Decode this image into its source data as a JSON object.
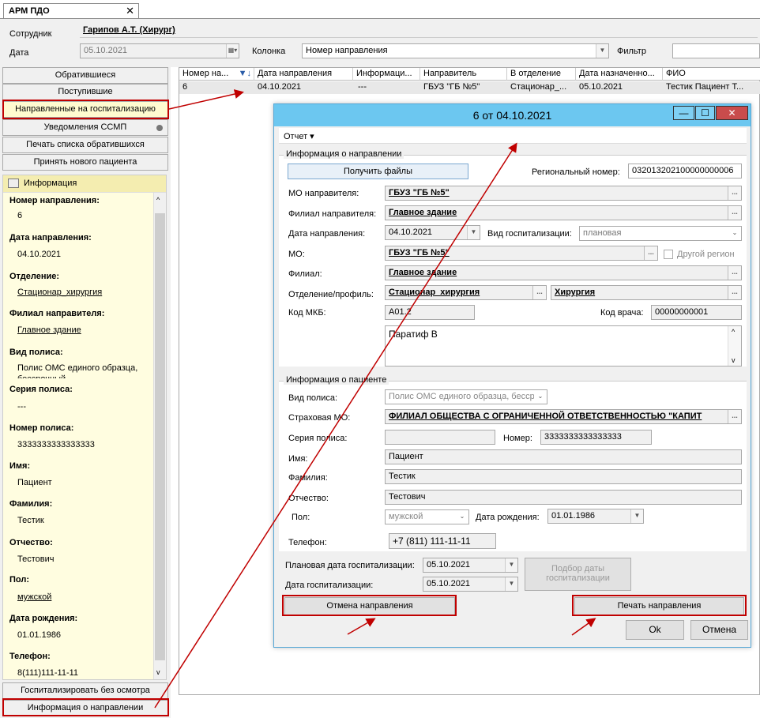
{
  "tab": {
    "title": "АРМ ПДО",
    "close": "✕"
  },
  "top": {
    "employee_label": "Сотрудник",
    "employee_value": "Гарипов А.Т. (Хирург)",
    "date_label": "Дата",
    "date_value": "05.10.2021",
    "column_label": "Колонка",
    "column_value": "Номер направления",
    "filter_label": "Фильтр",
    "filter_value": ""
  },
  "left_buttons": [
    "Обратившиеся",
    "Поступившие",
    "Направленные на госпитализацию",
    "Уведомления ССМП",
    "Печать списка обратившихся",
    "Принять нового пациента"
  ],
  "info": {
    "header": "Информация",
    "fields": [
      {
        "label": "Номер направления:",
        "value": "6"
      },
      {
        "label": "Дата направления:",
        "value": "04.10.2021"
      },
      {
        "label": "Отделение:",
        "value": "Стационар_хирургия"
      },
      {
        "label": "Филиал направителя:",
        "value": "Главное здание"
      },
      {
        "label": "Вид полиса:",
        "value": "Полис ОМС единого образца, бессрочный"
      },
      {
        "label": "Серия полиса:",
        "value": "---"
      },
      {
        "label": "Номер полиса:",
        "value": "3333333333333333"
      },
      {
        "label": "Имя:",
        "value": "Пациент"
      },
      {
        "label": "Фамилия:",
        "value": "Тестик"
      },
      {
        "label": "Отчество:",
        "value": "Тестович"
      },
      {
        "label": "Пол:",
        "value": "мужской"
      },
      {
        "label": "Дата рождения:",
        "value": "01.01.1986"
      },
      {
        "label": "Телефон:",
        "value": "8(111)111-11-11"
      }
    ]
  },
  "bottom_buttons": [
    "Госпитализировать без осмотра",
    "Информация о направлении"
  ],
  "grid": {
    "headers": [
      "Номер на...",
      "Дата направления",
      "Информаци...",
      "Направитель",
      "В отделение",
      "Дата назначенно...",
      "ФИО"
    ],
    "row": [
      "6",
      "04.10.2021",
      "---",
      "ГБУЗ \"ГБ №5\"",
      "Стационар_...",
      "05.10.2021",
      "Тестик Пациент Т..."
    ]
  },
  "dialog": {
    "title": "6 от 04.10.2021",
    "min": "—",
    "max": "☐",
    "close": "✕",
    "menu": "Отчет ▾",
    "sec1": "Информация о направлении",
    "get_files": "Получить файлы",
    "reg_num_label": "Региональный номер:",
    "reg_num": "032013202100000000006",
    "mo_dir_label": "МО направителя:",
    "mo_dir": "ГБУЗ \"ГБ №5\"",
    "fil_dir_label": "Филиал направителя:",
    "fil_dir": "Главное здание",
    "date_dir_label": "Дата направления:",
    "date_dir": "04.10.2021",
    "hosp_type_label": "Вид госпитализации:",
    "hosp_type": "плановая",
    "mo_label": "МО:",
    "mo": "ГБУЗ \"ГБ №5\"",
    "other_region": "Другой регион",
    "fil_label": "Филиал:",
    "fil": "Главное здание",
    "dept_label": "Отделение/профиль:",
    "dept": "Стационар_хирургия",
    "profile": "Хирургия",
    "mkb_label": "Код МКБ:",
    "mkb": "A01.2",
    "doc_code_label": "Код врача:",
    "doc_code": "00000000001",
    "diagnosis": "Паратиф В",
    "sec2": "Информация о пациенте",
    "policy_type_label": "Вид полиса:",
    "policy_type": "Полис ОМС единого образца, бесср",
    "insurer_label": "Страховая МО:",
    "insurer": "ФИЛИАЛ ОБЩЕСТВА С ОГРАНИЧЕННОЙ ОТВЕТСТВЕННОСТЬЮ \"КАПИТ",
    "series_label": "Серия полиса:",
    "series": "",
    "number_label": "Номер:",
    "number": "3333333333333333",
    "name_label": "Имя:",
    "name": "Пациент",
    "surname_label": "Фамилия:",
    "surname": "Тестик",
    "patronymic_label": "Отчество:",
    "patronymic": "Тестович",
    "sex_label": "Пол:",
    "sex": "мужской",
    "birth_label": "Дата рождения:",
    "birth": "01.01.1986",
    "phone_label": "Телефон:",
    "phone": "+7 (811) 111-11-11",
    "plan_date_label": "Плановая дата госпитализации:",
    "plan_date": "05.10.2021",
    "hosp_date_label": "Дата госпитализации:",
    "hosp_date": "05.10.2021",
    "pick_date_1": "Подбор даты",
    "pick_date_2": "госпитализации",
    "cancel_dir": "Отмена направления",
    "print_dir": "Печать направления",
    "ok": "Ok",
    "cancel": "Отмена"
  },
  "colors": {
    "accent_red": "#c00000",
    "title_blue": "#6cc7f0",
    "info_bg": "#fffde0"
  }
}
